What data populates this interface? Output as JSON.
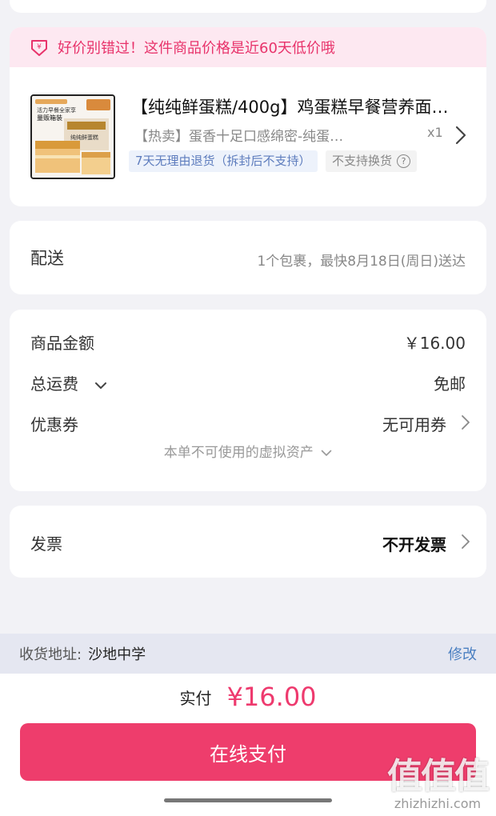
{
  "promo": {
    "icon": "price-tag-icon",
    "text": "好价别错过！这件商品价格是近60天低价哦"
  },
  "product": {
    "title": "【纯纯鲜蛋糕/400g】鸡蛋糕早餐营养面…",
    "subtitle": "【热卖】蛋香十足口感绵密-纯蛋…",
    "quantity": "x1",
    "tag_return": "7天无理由退货（拆封后不支持）",
    "tag_exchange": "不支持换货",
    "thumb_text": {
      "brand": "活力早餐全家享",
      "box": "量贩箱装",
      "flavor": "纯纯鲜蛋糕"
    }
  },
  "delivery": {
    "label": "配送",
    "value": "1个包裹，最快8月18日(周日)送达"
  },
  "amounts": {
    "goods_label": "商品金额",
    "goods_value": "￥16.00",
    "shipping_label": "总运费",
    "shipping_value": "免邮",
    "coupon_label": "优惠券",
    "coupon_value": "无可用券",
    "virtual_note": "本单不可使用的虚拟资产"
  },
  "invoice": {
    "label": "发票",
    "value": "不开发票"
  },
  "address": {
    "label": "收货地址:",
    "value": "沙地中学",
    "edit": "修改"
  },
  "payment": {
    "label": "实付",
    "amount": "¥16.00",
    "button": "在线支付"
  },
  "watermark": {
    "big": "值值值",
    "small": "zhizhizhi.com"
  },
  "colors": {
    "accent": "#ee3d6c",
    "promo_bg": "#fde8f1",
    "link": "#4a7fc1"
  }
}
